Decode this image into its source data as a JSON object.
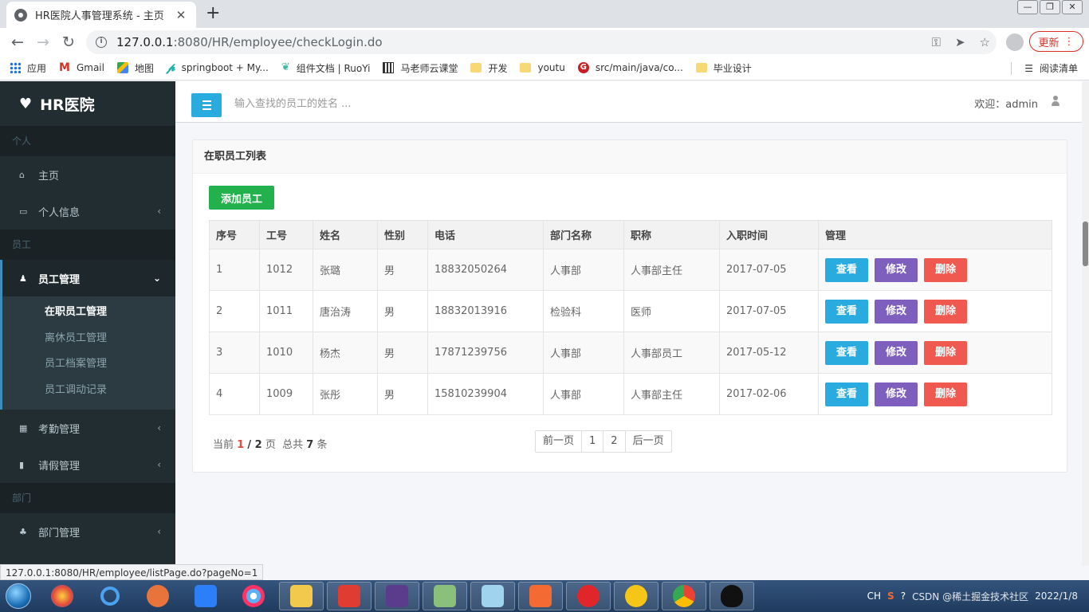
{
  "browser": {
    "tab_title": "HR医院人事管理系统 - 主页",
    "tab_close": "✕",
    "new_tab": "+",
    "url_host": "127.0.0.1",
    "url_path": ":8080/HR/employee/checkLogin.do",
    "update_label": "更新",
    "bookmarks": [
      {
        "label": "应用",
        "icon": "apps-icon"
      },
      {
        "label": "Gmail",
        "icon": "gmail-icon"
      },
      {
        "label": "地图",
        "icon": "maps-icon"
      },
      {
        "label": "springboot + My...",
        "icon": "springboot-icon"
      },
      {
        "label": "组件文档 | RuoYi",
        "icon": "ruoyi-icon"
      },
      {
        "label": "马老师云课堂",
        "icon": "qr-icon"
      },
      {
        "label": "开发",
        "icon": "folder-icon"
      },
      {
        "label": "youtu",
        "icon": "folder-icon"
      },
      {
        "label": "src/main/java/co...",
        "icon": "gitee-icon"
      },
      {
        "label": "毕业设计",
        "icon": "folder-icon"
      }
    ],
    "reading_list": "阅读清单",
    "status_url": "127.0.0.1:8080/HR/employee/listPage.do?pageNo=1"
  },
  "sidebar": {
    "brand": "HR医院",
    "sections": {
      "personal": "个人",
      "employee": "员工",
      "department": "部门"
    },
    "items": {
      "home": "主页",
      "profile": "个人信息",
      "emp_mgmt": "员工管理",
      "attendance": "考勤管理",
      "leave": "请假管理",
      "dept_mgmt": "部门管理"
    },
    "sub_items": [
      "在职员工管理",
      "离休员工管理",
      "员工档案管理",
      "员工调动记录"
    ]
  },
  "header": {
    "search_placeholder": "输入查找的员工的姓名 ...",
    "welcome": "欢迎：admin"
  },
  "panel": {
    "title": "在职员工列表",
    "add_button": "添加员工",
    "columns": [
      "序号",
      "工号",
      "姓名",
      "性别",
      "电话",
      "部门名称",
      "职称",
      "入职时间",
      "管理"
    ],
    "rows": [
      [
        "1",
        "1012",
        "张璐",
        "男",
        "18832050264",
        "人事部",
        "人事部主任",
        "2017-07-05"
      ],
      [
        "2",
        "1011",
        "唐治涛",
        "男",
        "18832013916",
        "检验科",
        "医师",
        "2017-07-05"
      ],
      [
        "3",
        "1010",
        "杨杰",
        "男",
        "17871239756",
        "人事部",
        "人事部员工",
        "2017-05-12"
      ],
      [
        "4",
        "1009",
        "张彤",
        "男",
        "15810239904",
        "人事部",
        "人事部主任",
        "2017-02-06"
      ]
    ],
    "actions": {
      "view": "查看",
      "edit": "修改",
      "delete": "删除"
    },
    "page_info": {
      "prefix": "当前",
      "current": "1",
      "slash_total": "/ 2",
      "page_word": "页",
      "total_prefix": "总共",
      "total": "7",
      "total_suffix": "条"
    },
    "pager": {
      "prev": "前一页",
      "p1": "1",
      "p2": "2",
      "next": "后一页"
    }
  },
  "taskbar": {
    "lang": "CH",
    "watermark": "CSDN @稀土掘金技术社区",
    "date": "2022/1/8"
  },
  "colors": {
    "sidebar_bg": "#222d32",
    "accent_blue": "#29abe0",
    "add_green": "#22b14c",
    "edit_purple": "#7e5fbd",
    "delete_red": "#f0594f"
  }
}
